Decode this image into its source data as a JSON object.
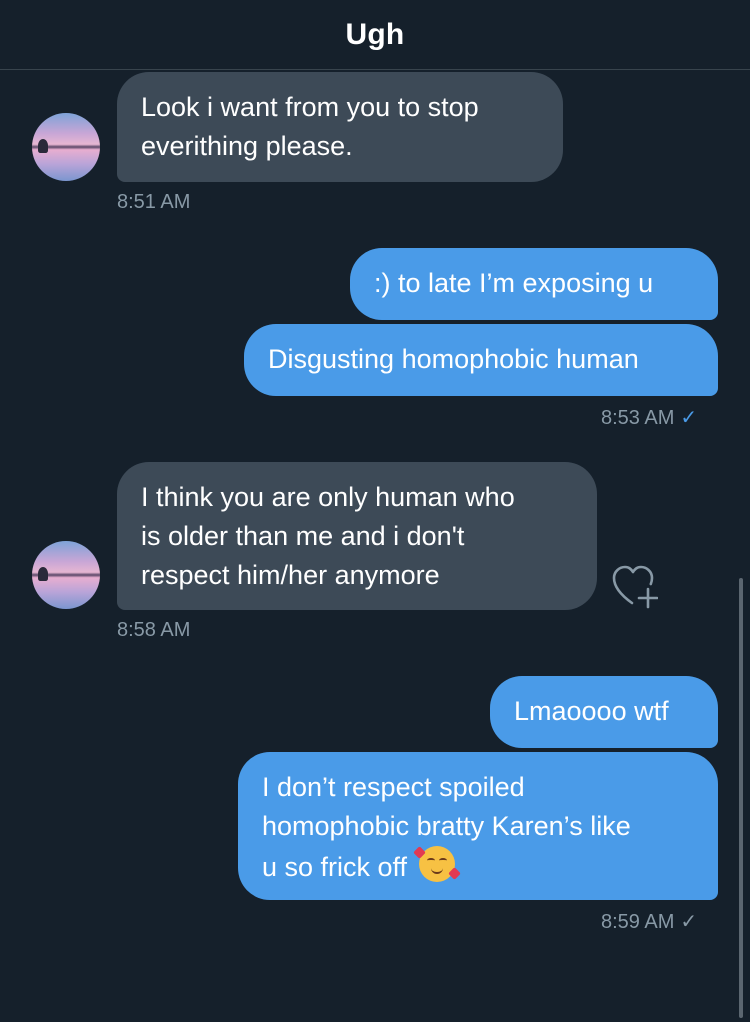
{
  "header": {
    "title": "Ugh"
  },
  "messages": [
    {
      "from": "them",
      "lines": [
        "Look i want from you to stop",
        "everithing please."
      ]
    },
    {
      "from": "me",
      "lines": [
        ":) to late I’m exposing u"
      ]
    },
    {
      "from": "me",
      "lines": [
        "Disgusting homophobic human"
      ]
    },
    {
      "from": "them",
      "lines": [
        "I think you are only human who",
        "is older than me and i don't",
        "respect him/her anymore"
      ]
    },
    {
      "from": "me",
      "lines": [
        "Lmaoooo wtf"
      ]
    },
    {
      "from": "me",
      "lines": [
        "I don’t respect spoiled",
        "homophobic bratty Karen’s like",
        "u so frick off"
      ],
      "emoji": "smiling-face-with-hearts"
    }
  ],
  "timestamps": {
    "t1": "8:51 AM",
    "t2": "8:53 AM",
    "t3": "8:58 AM",
    "t4": "8:59 AM"
  },
  "status": {
    "t2_read": "✓",
    "t4_read": "✓"
  },
  "colors": {
    "background": "#15202b",
    "incoming_bubble": "#3d4a57",
    "outgoing_bubble": "#4a9be8",
    "timestamp": "#8899a6"
  },
  "icons": [
    "avatar",
    "heart-add-icon",
    "check-icon",
    "smiling-face-with-hearts-emoji"
  ]
}
